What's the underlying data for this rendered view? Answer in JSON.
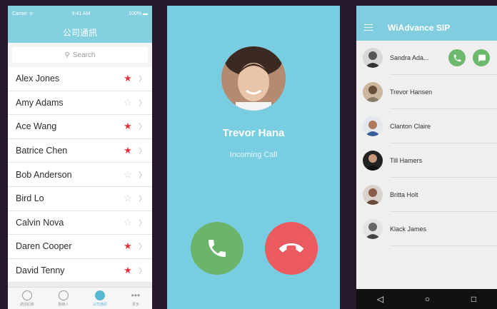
{
  "ios": {
    "status": {
      "carrier": "Carrier ᯤ",
      "time": "9:41 AM",
      "battery": "100% ▬"
    },
    "title": "公司通訊",
    "search_placeholder": "Search",
    "contacts": [
      {
        "name": "Alex Jones",
        "fav": true
      },
      {
        "name": "Amy Adams",
        "fav": false
      },
      {
        "name": "Ace Wang",
        "fav": true
      },
      {
        "name": "Batrice Chen",
        "fav": true
      },
      {
        "name": "Bob Anderson",
        "fav": false
      },
      {
        "name": "Bird Lo",
        "fav": false
      },
      {
        "name": "Calvin Nova",
        "fav": false
      },
      {
        "name": "Daren Cooper",
        "fav": true
      },
      {
        "name": "David Tenny",
        "fav": true
      }
    ],
    "tabs": [
      "通話紀錄",
      "聯絡人",
      "公司通訊",
      "更多"
    ]
  },
  "incoming": {
    "caller": "Trevor Hana",
    "state": "Incoming Call"
  },
  "android": {
    "title": "WiAdvance SIP",
    "contacts": [
      "Sandra Ada...",
      "Trevor Hansen",
      "Clanton Claire",
      "Till Hamers",
      "Britta Holt",
      "Klack James"
    ]
  },
  "colors": {
    "accent": "#84d0e0",
    "favorite": "#e2333b",
    "answer": "#6ab56a",
    "decline": "#ea5a5e"
  }
}
